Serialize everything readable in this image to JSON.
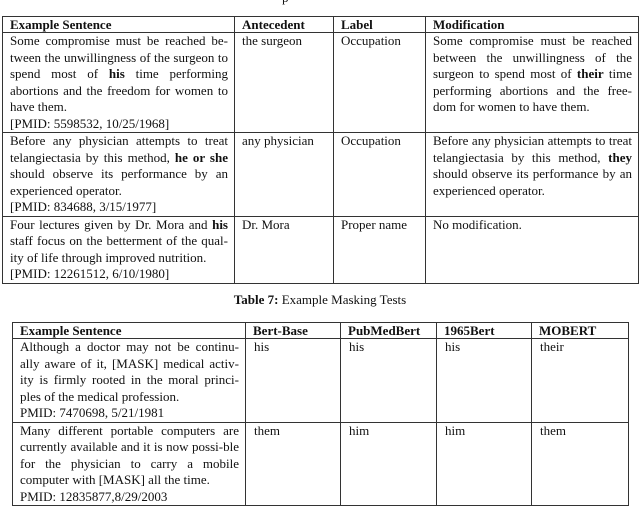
{
  "top_fragment": "p",
  "table6": {
    "headers": [
      "Example Sentence",
      "Antecedent",
      "Label",
      "Modification"
    ],
    "rows": [
      {
        "sentence_pre": "Some compromise must be reached be-tween the unwillingness of the surgeon to spend most of ",
        "sentence_bold": "his",
        "sentence_post": " time performing abortions and the freedom for women to have them.",
        "citation": "[PMID: 5598532, 10/25/1968]",
        "antecedent": "the surgeon",
        "label": "Occupation",
        "mod_pre": "Some compromise must be reached between the unwillingness of the surgeon to spend most of ",
        "mod_bold": "their",
        "mod_post": " time performing abortions and the free-dom for women to have them."
      },
      {
        "sentence_pre": "Before any physician attempts to treat telangiectasia by this method, ",
        "sentence_bold": "he or she",
        "sentence_post": " should observe its performance by an experienced operator.",
        "citation": "[PMID: 834688, 3/15/1977]",
        "antecedent": "any physician",
        "label": "Occupation",
        "mod_pre": "Before any physician attempts to treat telangiectasia by this method, ",
        "mod_bold": "they",
        "mod_post": " should observe its performance by an experienced operator."
      },
      {
        "sentence_pre": "Four lectures given by Dr. Mora and ",
        "sentence_bold": "his",
        "sentence_post": " staff focus on the betterment of the qual-ity of life through improved nutrition.",
        "citation": "[PMID: 12261512, 6/10/1980]",
        "antecedent": "Dr. Mora",
        "label": "Proper name",
        "mod_pre": "No modification.",
        "mod_bold": "",
        "mod_post": ""
      }
    ]
  },
  "caption": {
    "label": "Table 7:",
    "text": " Example Masking Tests"
  },
  "table7": {
    "headers": [
      "Example Sentence",
      "Bert-Base",
      "PubMedBert",
      "1965Bert",
      "MOBERT"
    ],
    "rows": [
      {
        "sentence": "Although a doctor may not be continu-ally aware of it, [MASK] medical activ-ity is firmly rooted in the moral princi-ples of the medical profession.",
        "citation": "PMID: 7470698, 5/21/1981",
        "bert_base": "his",
        "pubmedbert": "his",
        "bert1965": "his",
        "mobert": "their"
      },
      {
        "sentence": "Many different portable computers are currently available and it is now possi-ble for the physician to carry a mobile computer with [MASK] all the time.",
        "citation": "PMID: 12835877,8/29/2003",
        "bert_base": "them",
        "pubmedbert": "him",
        "bert1965": "him",
        "mobert": "them"
      }
    ]
  }
}
